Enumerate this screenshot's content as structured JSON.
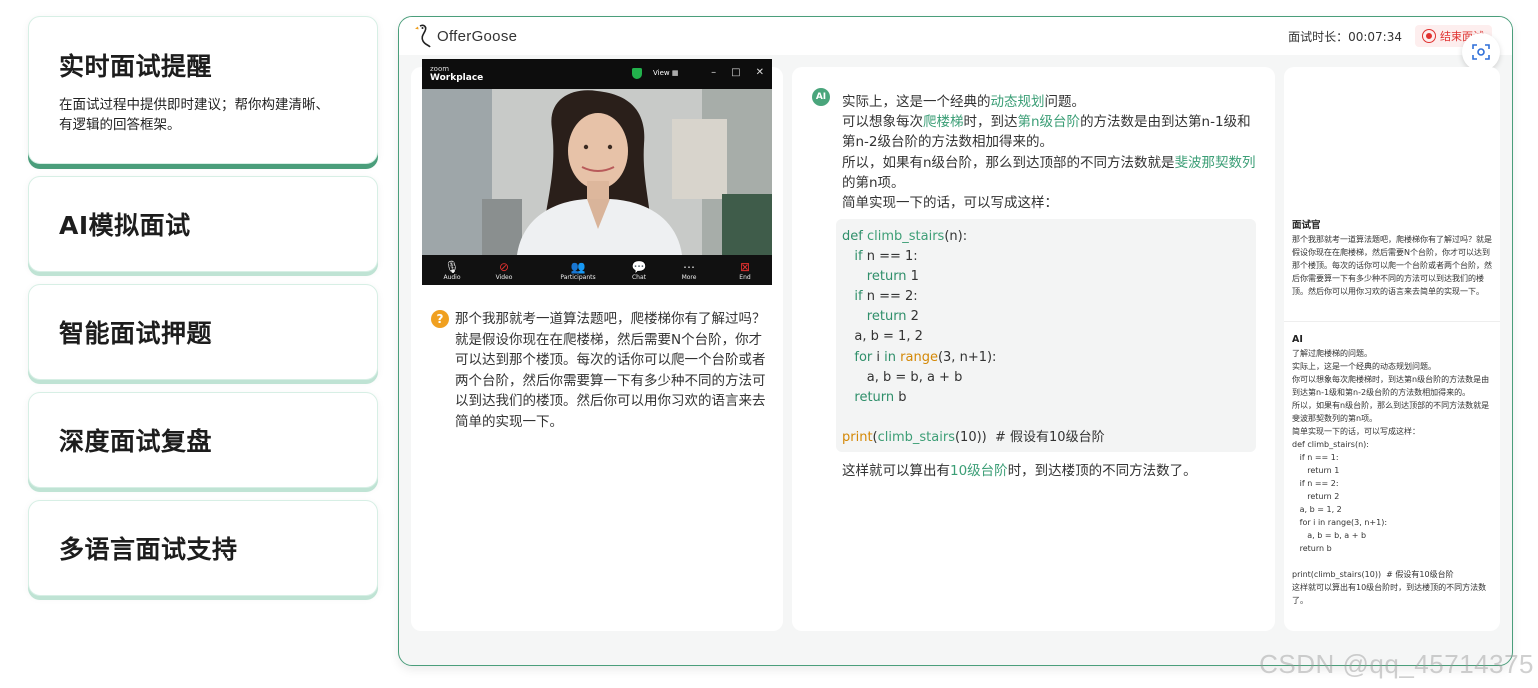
{
  "features": [
    {
      "title": "实时面试提醒",
      "desc": "在面试过程中提供即时建议；帮你构建清晰、有逻辑的回答框架。"
    },
    {
      "title": "AI模拟面试"
    },
    {
      "title": "智能面试押题"
    },
    {
      "title": "深度面试复盘"
    },
    {
      "title": "多语言面试支持"
    }
  ],
  "app": {
    "logo_text": "OfferGoose",
    "timer_label": "面试时长：",
    "timer_value": "00:07:34",
    "end_label": "结束面试"
  },
  "zoom": {
    "brand_top": "zoom",
    "brand_bottom": "Workplace",
    "view_label": "View",
    "controls": [
      "Audio",
      "Video",
      "Participants",
      "Chat",
      "More",
      "End"
    ]
  },
  "question": {
    "icon": "?",
    "text": "那个我那就考一道算法题吧，爬楼梯你有了解过吗？就是假设你现在在爬楼梯，然后需要N个台阶，你才可以达到那个楼顶。每次的话你可以爬一个台阶或者两个台阶，然后你需要算一下有多少种不同的方法可以到达我们的楼顶。然后你可以用你习欢的语言来去简单的实现一下。"
  },
  "answer": {
    "badge": "AI",
    "l1a": "实际上，这是一个经典的",
    "l1b": "动态规划",
    "l1c": "问题。",
    "l2a": "可以想象每次",
    "l2b": "爬楼梯",
    "l2c": "时，到达",
    "l2d": "第n级台阶",
    "l2e": "的方法数是由到达第n-1级和第n-2级台阶的方法数相加得来的。",
    "l3a": "所以，如果有n级台阶，那么到达顶部的不同方法数就是",
    "l3b": "斐波那契数列",
    "l3c": "的第n项。",
    "l4": "简单实现一下的话，可以写成这样：",
    "code": {
      "def": "def",
      "fname": "climb_stairs",
      "params": "(n):",
      "if1": "if",
      "if1_rest": " n == 1:",
      "ret1": "return",
      "ret1_val": " 1",
      "if2": "if",
      "if2_rest": " n == 2:",
      "ret2": "return",
      "ret2_val": " 2",
      "assign": "a, b = 1, 2",
      "for": "for",
      "for_mid": " i ",
      "in": "in",
      "range": " range",
      "range_args": "(3, n+1):",
      "swap": "a, b = b, a + b",
      "ret3": "return",
      "ret3_val": " b",
      "print": "print",
      "print_p1": "(",
      "print_fn": "climb_stairs",
      "print_p2": "(10))  # 假设有10级台阶"
    },
    "after_a": "这样就可以算出有",
    "after_b": "10级台阶",
    "after_c": "时，到达楼顶的不同方法数了。"
  },
  "transcript": {
    "interviewer_label": "面试官",
    "interviewer_text": "那个我那就考一道算法题吧，爬楼梯你有了解过吗？就是假设你现在在爬楼梯，然后需要N个台阶，你才可以达到那个楼顶。每次的话你可以爬一个台阶或者两个台阶，然后你需要算一下有多少种不同的方法可以到达我们的楼顶。然后你可以用你习欢的语言来去简单的实现一下。",
    "ai_label": "AI",
    "ai_text_1": "了解过爬楼梯的问题。",
    "ai_text_2": "实际上，这是一个经典的动态规划问题。",
    "ai_text_3": "你可以想象每次爬楼梯时，到达第n级台阶的方法数是由到达第n-1级和第n-2级台阶的方法数相加得来的。",
    "ai_text_4": "所以，如果有n级台阶，那么到达顶部的不同方法数就是斐波那契数列的第n项。",
    "ai_text_5": "简单实现一下的话，可以写成这样：",
    "ai_code": "def climb_stairs(n):\n   if n == 1:\n      return 1\n   if n == 2:\n      return 2\n   a, b = 1, 2\n   for i in range(3, n+1):\n      a, b = b, a + b\n   return b\n\nprint(climb_stairs(10))  # 假设有10级台阶",
    "ai_text_6": "这样就可以算出有10级台阶时，到达楼顶的不同方法数了。"
  },
  "watermark": "CSDN @qq_45714375"
}
